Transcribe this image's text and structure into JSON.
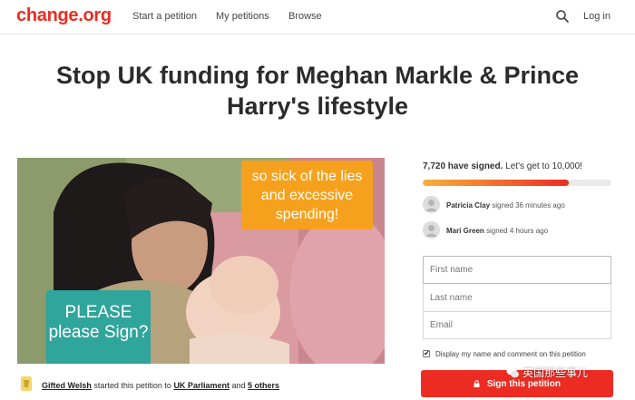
{
  "header": {
    "logo": "change.org",
    "nav": [
      "Start a petition",
      "My petitions",
      "Browse"
    ],
    "login_label": "Log in",
    "search_icon": "search-icon"
  },
  "petition": {
    "title": "Stop UK funding for Meghan Markle & Prince Harry's lifestyle",
    "image": {
      "overlay_orange": "so sick of the lies and excessive spending!",
      "overlay_teal": "PLEASE please Sign?"
    },
    "starter": {
      "name": "Gifted Welsh",
      "text_1": "started this petition to",
      "target": "UK Parliament",
      "text_2": "and",
      "others": "5 others"
    }
  },
  "signatures": {
    "count_label": "7,720 have signed.",
    "goal_text": "Let's get to 10,000!",
    "progress_fraction": 0.772,
    "recent": [
      {
        "name": "Patricia Clay",
        "action": "signed 36 minutes ago"
      },
      {
        "name": "Mari Green",
        "action": "signed 4 hours ago"
      }
    ]
  },
  "form": {
    "first_name_placeholder": "First name",
    "last_name_placeholder": "Last name",
    "email_placeholder": "Email",
    "display_checkbox_label": "Display my name and comment on this petition",
    "display_checked": true,
    "sign_button_label": "Sign this petition"
  },
  "watermark": {
    "text": "英国那些事儿"
  },
  "colors": {
    "brand": "#ec2c22",
    "orange": "#f6a11d",
    "teal": "#2fa59b"
  }
}
